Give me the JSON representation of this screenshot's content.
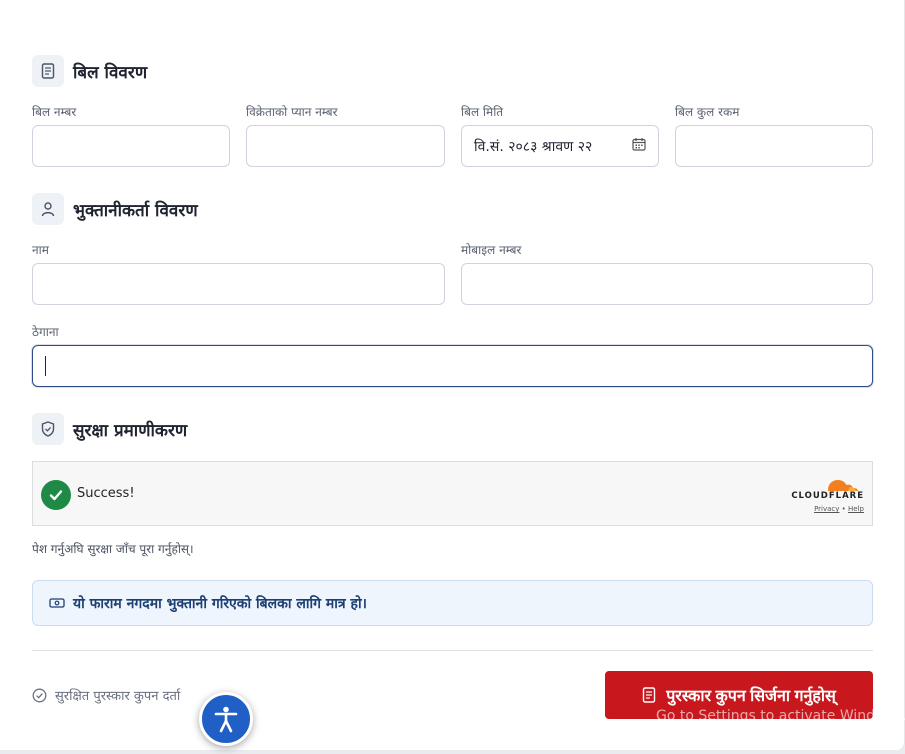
{
  "sections": {
    "bill": {
      "title": "बिल विवरण",
      "icon": "document-icon"
    },
    "payer": {
      "title": "भुक्तानीकर्ता विवरण",
      "icon": "user-icon"
    },
    "security": {
      "title": "सुरक्षा प्रमाणीकरण",
      "icon": "shield-check-icon"
    }
  },
  "bill_fields": {
    "bill_number": {
      "label": "बिल नम्बर",
      "value": ""
    },
    "seller_pan": {
      "label": "विक्रेताको प्यान नम्बर",
      "value": ""
    },
    "bill_date": {
      "label": "बिल मिति",
      "value": "वि.सं. २०८३ श्रावण २२",
      "icon": "calendar-icon"
    },
    "bill_total": {
      "label": "बिल कुल रकम",
      "value": ""
    }
  },
  "payer_fields": {
    "name": {
      "label": "नाम",
      "value": ""
    },
    "mobile": {
      "label": "मोबाइल नम्बर",
      "value": ""
    },
    "address": {
      "label": "ठेगाना",
      "value": ""
    }
  },
  "captcha": {
    "status": "Success!",
    "brand": "CLOUDFLARE",
    "privacy": "Privacy",
    "separator": "•",
    "help": "Help"
  },
  "hint": "पेश गर्नुअघि सुरक्षा जाँच पूरा गर्नुहोस्।",
  "info_notice": {
    "text": "यो फाराम नगदमा भुक्तानी गरिएको बिलका लागि मात्र हो।",
    "icon": "cash-icon"
  },
  "footer": {
    "note": "सुरक्षित पुरस्कार कुपन दर्ता",
    "submit_label": "पुरस्कार कुपन सिर्जना गर्नुहोस्"
  },
  "overlay": {
    "windows_watermark": "Go to Settings to activate Windows."
  },
  "colors": {
    "submit": "#c8181e",
    "success": "#1e8a45",
    "focus_border": "#2b4e86",
    "info_bg": "#eef5fd",
    "cloudflare_orange": "#f38020",
    "accessibility_button": "#1f5fc6"
  }
}
